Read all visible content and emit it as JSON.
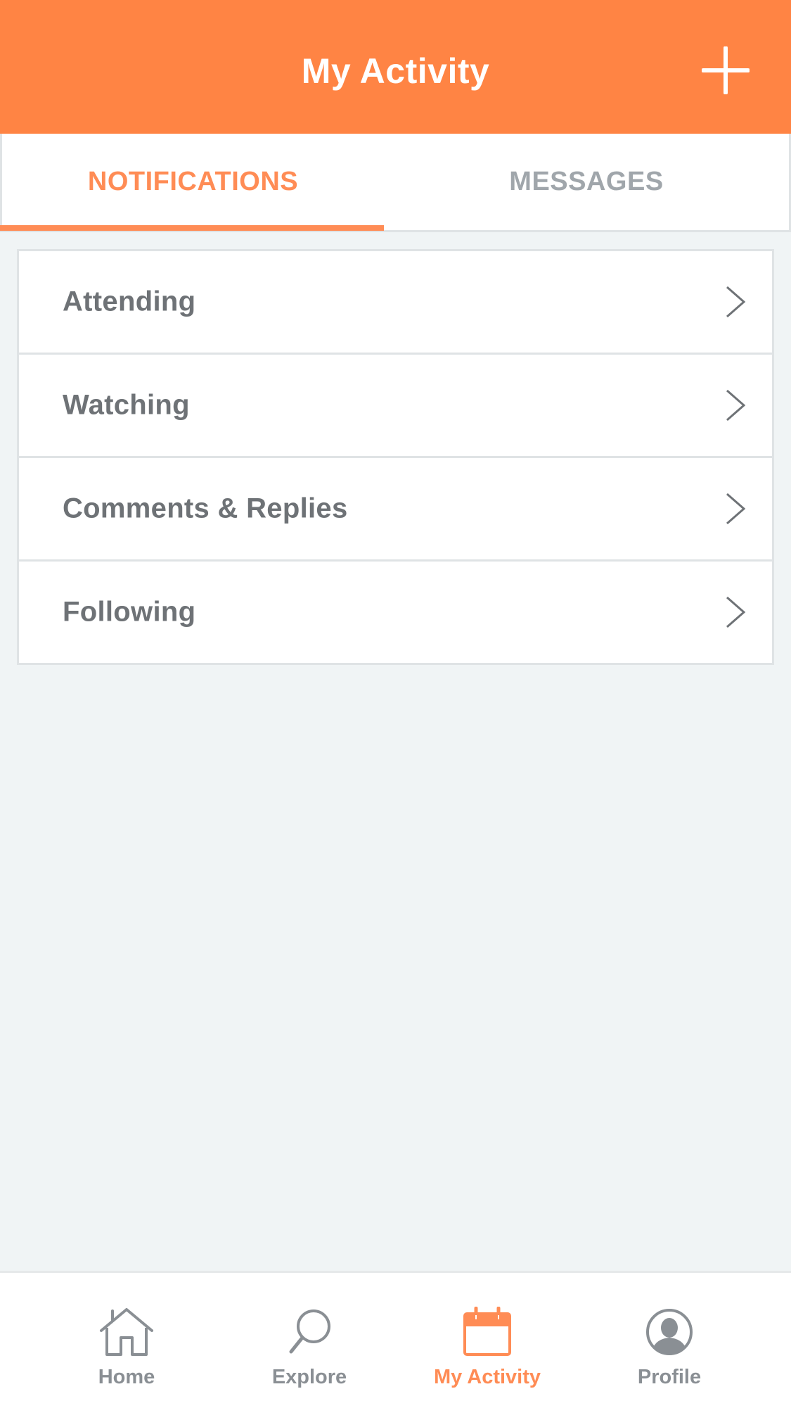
{
  "header": {
    "title": "My Activity",
    "add_icon": "plus-icon"
  },
  "tabs": [
    {
      "label": "NOTIFICATIONS",
      "active": true
    },
    {
      "label": "MESSAGES",
      "active": false
    }
  ],
  "notifications": {
    "items": [
      {
        "label": "Attending",
        "icon": "chevron-right-icon"
      },
      {
        "label": "Watching",
        "icon": "chevron-right-icon"
      },
      {
        "label": "Comments & Replies",
        "icon": "chevron-right-icon"
      },
      {
        "label": "Following",
        "icon": "chevron-right-icon"
      }
    ]
  },
  "bottom_nav": {
    "items": [
      {
        "label": "Home",
        "icon": "home-icon",
        "active": false
      },
      {
        "label": "Explore",
        "icon": "search-icon",
        "active": false
      },
      {
        "label": "My Activity",
        "icon": "calendar-icon",
        "active": true
      },
      {
        "label": "Profile",
        "icon": "profile-icon",
        "active": false
      }
    ]
  },
  "colors": {
    "accent": "#ff8444",
    "accent_text": "#ff8c55",
    "inactive_text": "#a0a6ab",
    "background": "#f0f4f5"
  }
}
